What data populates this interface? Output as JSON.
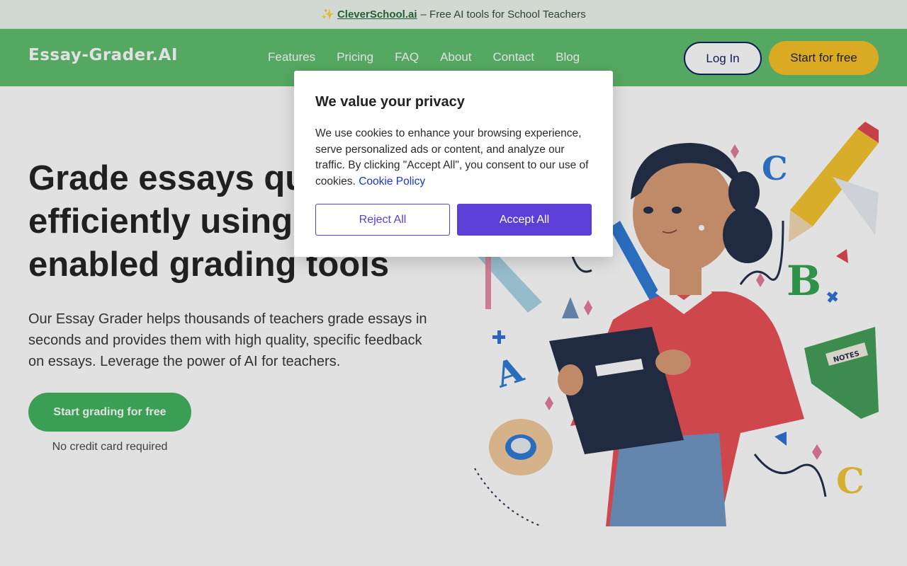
{
  "announcement": {
    "spark_icon": "sparkles-icon",
    "link_text": "CleverSchool.ai",
    "text": "– Free AI tools for School Teachers"
  },
  "header": {
    "logo": "Essay-Grader.AI",
    "nav": [
      "Features",
      "Pricing",
      "FAQ",
      "About",
      "Contact",
      "Blog"
    ],
    "login_label": "Log In",
    "start_label": "Start for free"
  },
  "hero": {
    "headline": "Grade essays quickly and efficiently using our AI-enabled grading tools",
    "subtext": "Our Essay Grader helps thousands of teachers grade essays in seconds and provides them with high quality, specific feedback on essays. Leverage the power of AI for teachers.",
    "cta_label": "Start grading for free",
    "cta_note": "No credit card required"
  },
  "cookie_modal": {
    "title": "We value your privacy",
    "body": "We use cookies to enhance your browsing experience, serve personalized ads or content, and analyze our traffic. By clicking \"Accept All\", you consent to our use of cookies.",
    "policy_link": "Cookie Policy",
    "reject_label": "Reject All",
    "accept_label": "Accept All"
  },
  "colors": {
    "header_green": "#5dbd6a",
    "cta_green": "#3eb25c",
    "start_yellow": "#f8bf22",
    "modal_purple": "#5b3fd6"
  }
}
